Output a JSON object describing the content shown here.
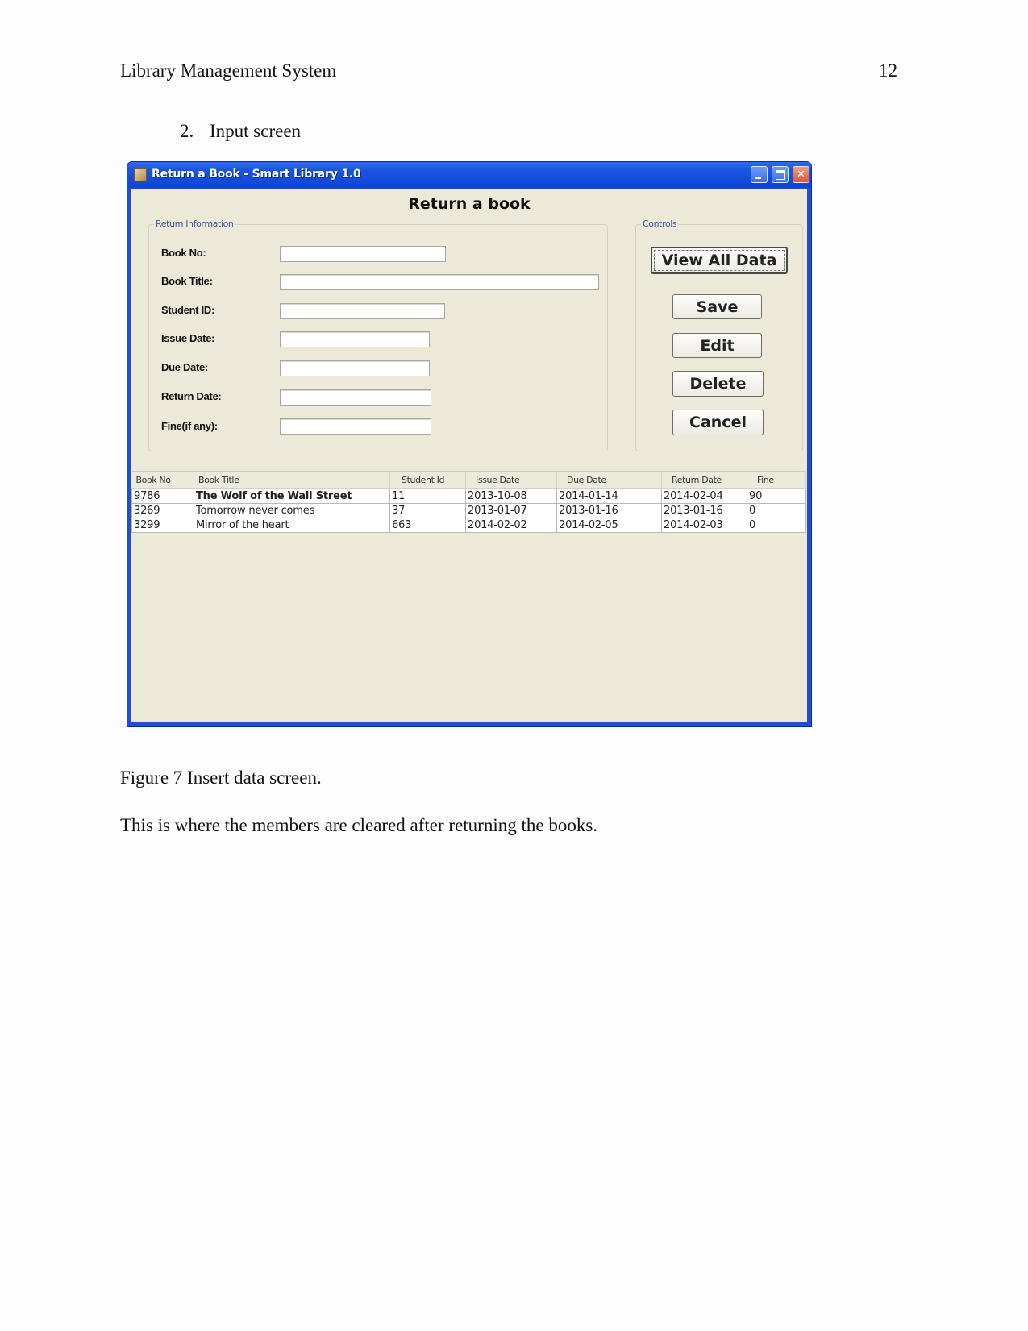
{
  "document": {
    "running_head": "Library Management System",
    "page_number": "12",
    "section_number": "2.",
    "section_title": "Input screen",
    "figure_caption": "Figure 7 Insert data screen.",
    "body_paragraph": "This is where the members are cleared after returning the books."
  },
  "window": {
    "title": "Return a Book - Smart Library 1.0",
    "form_title": "Return a book",
    "titlebar_color": "#1f4fd1",
    "client_bg": "#ece9d8"
  },
  "return_info": {
    "legend": "Return Information",
    "fields": [
      {
        "label": "Book No:",
        "value": ""
      },
      {
        "label": "Book Title:",
        "value": ""
      },
      {
        "label": "Student ID:",
        "value": ""
      },
      {
        "label": "Issue Date:",
        "value": ""
      },
      {
        "label": "Due Date:",
        "value": ""
      },
      {
        "label": "Return Date:",
        "value": ""
      },
      {
        "label": "Fine(if any):",
        "value": ""
      }
    ]
  },
  "controls": {
    "legend": "Controls",
    "view_all": "View All Data",
    "save": "Save",
    "edit": "Edit",
    "delete": "Delete",
    "cancel": "Cancel"
  },
  "table": {
    "columns": [
      "Book No",
      "Book Title",
      "Student Id",
      "Issue Date",
      "Due Date",
      "Return Date",
      "Fine"
    ],
    "rows": [
      [
        "9786",
        "The Wolf of the Wall Street",
        "11",
        "2013-10-08",
        "2014-01-14",
        "2014-02-04",
        "90"
      ],
      [
        "3269",
        "Tomorrow never comes",
        "37",
        "2013-01-07",
        "2013-01-16",
        "2013-01-16",
        "0"
      ],
      [
        "3299",
        "Mirror of the heart",
        "663",
        "2014-02-02",
        "2014-02-05",
        "2014-02-03",
        "0"
      ]
    ]
  }
}
